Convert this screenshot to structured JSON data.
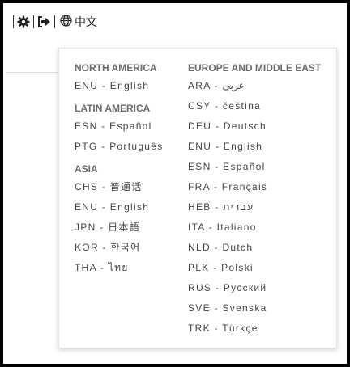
{
  "toolbar": {
    "language_label": "中文",
    "icons": [
      "gear-icon",
      "logout-icon",
      "globe-icon"
    ]
  },
  "dropdown": {
    "north_america": {
      "title": "NORTH AMERICA",
      "items": [
        "ENU - English"
      ]
    },
    "latin_america": {
      "title": "LATIN AMERICA",
      "items": [
        "ESN - Español",
        "PTG - Português"
      ]
    },
    "asia": {
      "title": "ASIA",
      "items": [
        "CHS - 普通话",
        "ENU - English",
        "JPN - 日本語",
        "KOR - 한국어",
        "THA - ไทย"
      ]
    },
    "europe_middle_east": {
      "title": "EUROPE AND MIDDLE EAST",
      "items": [
        "ARA - عربى",
        "CSY - čeština",
        "DEU - Deutsch",
        "ENU - English",
        "ESN - Español",
        "FRA - Français",
        "HEB - עברית",
        "ITA - Italiano",
        "NLD - Dutch",
        "PLK - Polski",
        "RUS - Русский",
        "SVE - Svenska",
        "TRK - Türkçe"
      ]
    }
  }
}
